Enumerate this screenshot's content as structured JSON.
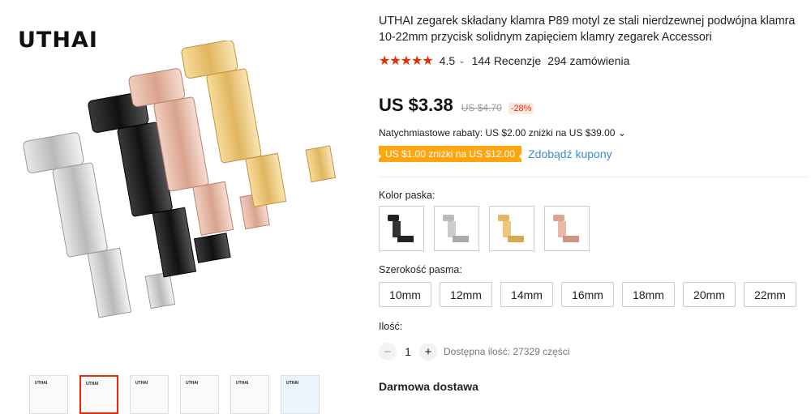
{
  "brand": "UTHAI",
  "product": {
    "title": "UTHAI zegarek składany klamra P89 motyl ze stali nierdzewnej podwójna klamra 10-22mm przycisk solidnym zapięciem klamry zegarek Accessori",
    "stars": "★★★★★",
    "rating": "4.5",
    "rating_chevron": "⌄",
    "reviews": "144 Recenzje",
    "orders": "294 zamówienia"
  },
  "price": {
    "current": "US $3.38",
    "old": "US $4.70",
    "discount": "-28%"
  },
  "instant_discount": "Natychmiastowe rabaty: US $2.00 zniżki na US $39.00 ⌄",
  "coupon": {
    "label": "US $1.00 zniżki na US $12.00",
    "get": "Zdobądź kupony"
  },
  "color_label": "Kolor paska:",
  "colors": [
    "black",
    "silver",
    "gold",
    "rose-gold"
  ],
  "width_label": "Szerokość pasma:",
  "sizes": [
    "10mm",
    "12mm",
    "14mm",
    "16mm",
    "18mm",
    "20mm",
    "22mm"
  ],
  "quantity": {
    "label": "Ilość:",
    "minus": "−",
    "value": "1",
    "plus": "+",
    "available": "Dostępna ilość: 27329 części"
  },
  "shipping": "Darmowa dostawa",
  "thumbs_mini": "UTHAI"
}
